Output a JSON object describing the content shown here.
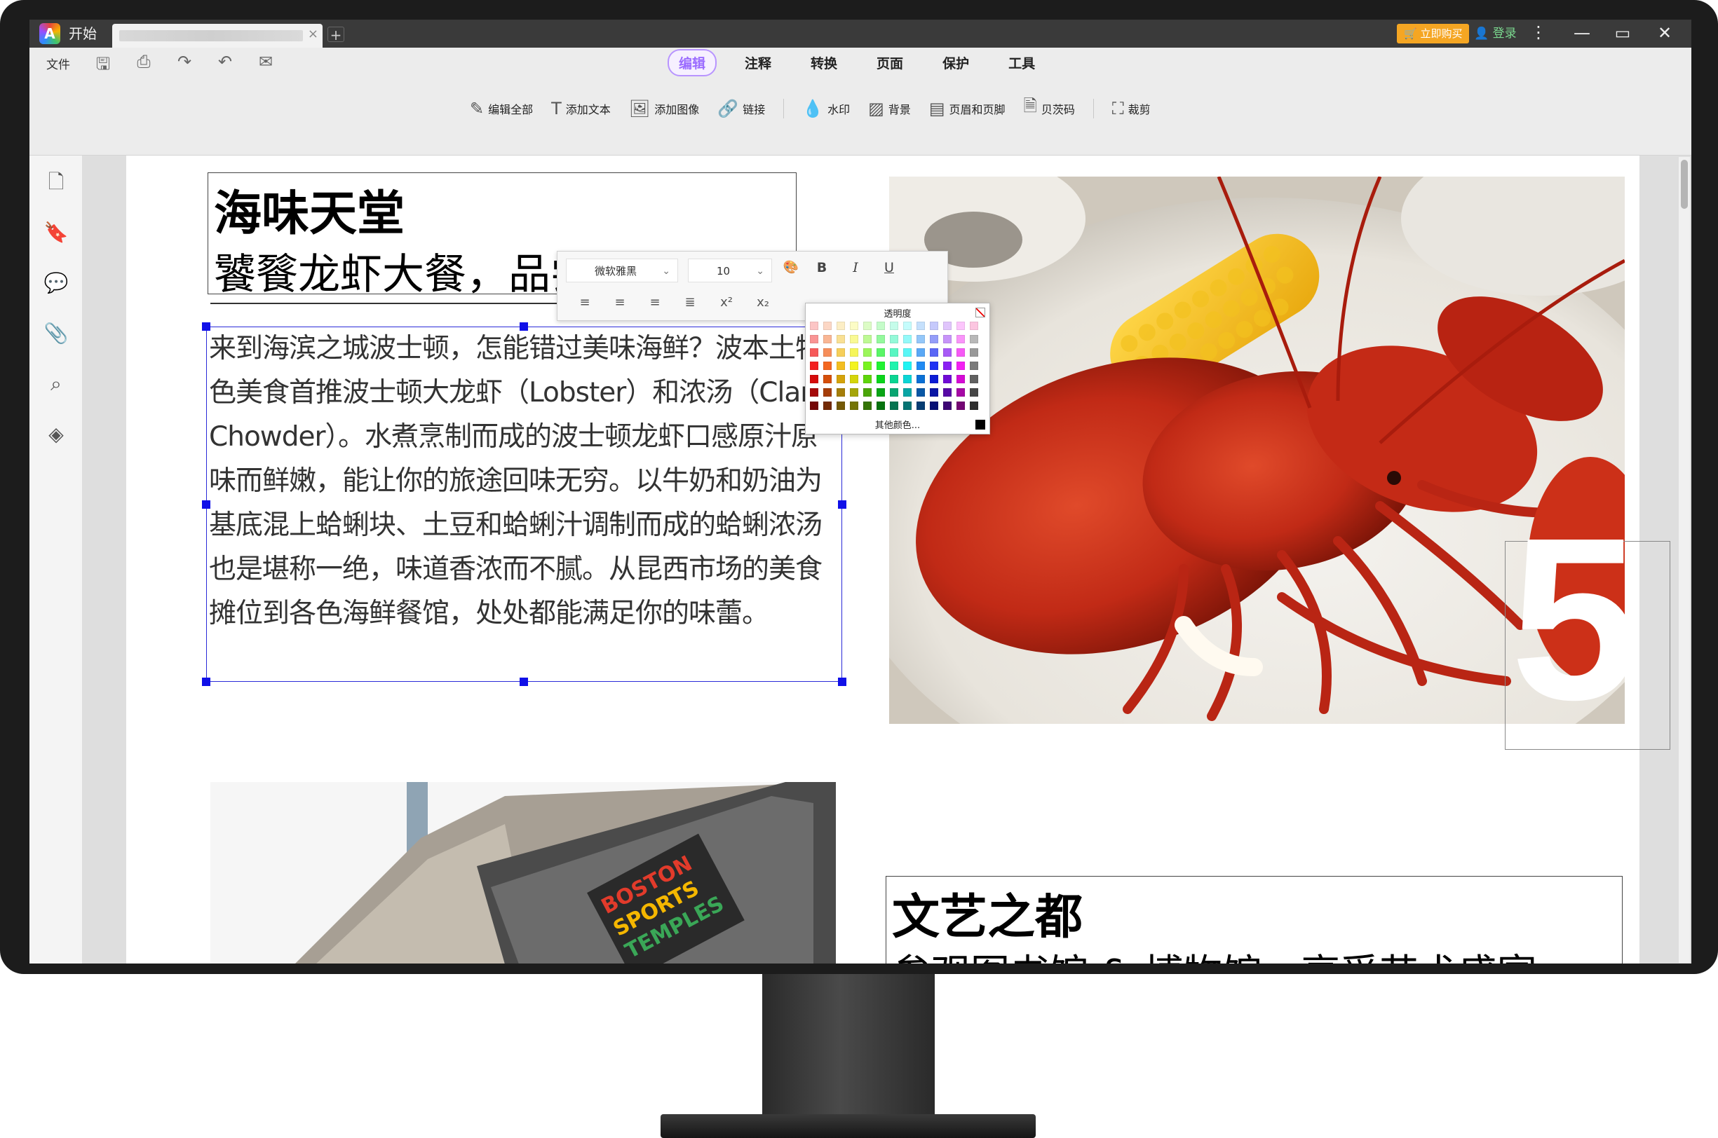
{
  "window": {
    "home_tab": "开始",
    "buy_label": "立即购买",
    "login_label": "登录",
    "minimize": "—",
    "maximize": "▭",
    "close": "✕",
    "new_tab": "+"
  },
  "ribbon": {
    "file_menu": "文件",
    "menu_tabs": [
      {
        "label": "编辑",
        "active": true
      },
      {
        "label": "注释"
      },
      {
        "label": "转换"
      },
      {
        "label": "页面"
      },
      {
        "label": "保护"
      },
      {
        "label": "工具"
      }
    ],
    "tools": [
      {
        "label": "编辑全部",
        "icon": "edit-all-icon"
      },
      {
        "label": "添加文本",
        "icon": "add-text-icon"
      },
      {
        "label": "添加图像",
        "icon": "add-image-icon"
      },
      {
        "label": "链接",
        "icon": "link-icon"
      },
      {
        "label": "水印",
        "icon": "watermark-icon"
      },
      {
        "label": "背景",
        "icon": "background-icon"
      },
      {
        "label": "页眉和页脚",
        "icon": "header-footer-icon"
      },
      {
        "label": "贝茨码",
        "icon": "bates-icon"
      },
      {
        "label": "裁剪",
        "icon": "crop-icon"
      }
    ]
  },
  "format_toolbar": {
    "font": "微软雅黑",
    "size": "10",
    "bold": "B",
    "italic": "I",
    "underline": "U",
    "superscript": "x²",
    "subscript": "x₂"
  },
  "color_palette": {
    "title": "透明度",
    "more_colors": "其他颜色..."
  },
  "document": {
    "section1_title": "海味天堂",
    "section1_subtitle": "饕餮龙虾大餐，品尝蛤蜊浓汤",
    "section1_body": "来到海滨之城波士顿，怎能错过美味海鲜？波本土特色美食首推波士顿大龙虾（Lobster）和浓汤（Clam Chowder）。水煮烹制而成的波士顿龙虾口感原汁原味而鲜嫩，能让你的旅途回味无穷。以牛奶和奶油为基底混上蛤蜊块、土豆和蛤蜊汁调制而成的蛤蜊浓汤也是堪称一绝，味道香浓而不腻。从昆西市场的美食摊位到各色海鲜餐馆，处处都能满足你的味蕾。",
    "page_number": "5",
    "section2_title": "文艺之都",
    "section2_subtitle": "参观图书馆 & 博物馆，享受艺术盛宴"
  }
}
